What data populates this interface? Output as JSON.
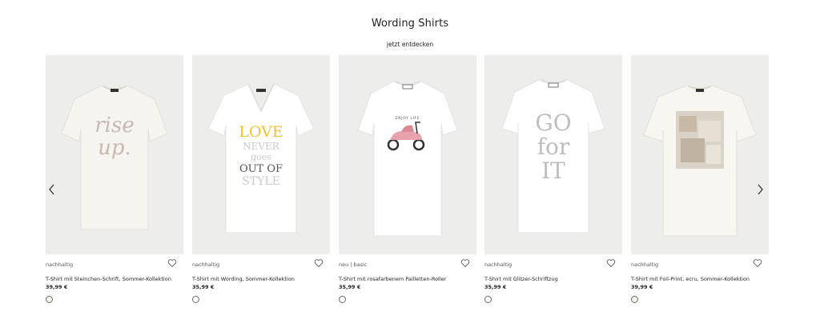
{
  "header": {
    "title": "Wording Shirts",
    "link": "jetzt entdecken"
  },
  "carousel": {
    "prev_icon": "chevron-left-icon",
    "next_icon": "chevron-right-icon",
    "products": [
      {
        "tag": "nachhaltig",
        "name": "T-Shirt mit Steinchen-Schrift, Sommer-Kollektion",
        "price": "39,99 €",
        "swatch": "#f5f3ea",
        "print": [
          "rise",
          "up."
        ],
        "shirt_color": "#f6f4ee"
      },
      {
        "tag": "nachhaltig",
        "name": "T-Shirt mit Wording, Sommer-Kollektion",
        "price": "35,99 €",
        "swatch": "#ffffff",
        "print": [
          "LOVE",
          "NEVER",
          "goes",
          "OUT OF",
          "STYLE"
        ],
        "shirt_color": "#ffffff"
      },
      {
        "tag": "neu   | basic",
        "name": "T-Shirt mit rosafarbenem Pailletten-Roller",
        "price": "35,99 €",
        "swatch": "#ffffff",
        "print": [
          "ENJOY LIFE"
        ],
        "shirt_color": "#ffffff"
      },
      {
        "tag": "nachhaltig",
        "name": "T-Shirt mit Glitzer-Schriftzug",
        "price": "35,99 €",
        "swatch": "#ffffff",
        "print": [
          "GO",
          "for",
          "IT"
        ],
        "shirt_color": "#ffffff"
      },
      {
        "tag": "nachhaltig",
        "name": "T-Shirt mit Foil-Print, ecru, Sommer-Kollektion",
        "price": "39,99 €",
        "swatch": "#f5f3ea",
        "print": [],
        "shirt_color": "#f7f6f1"
      }
    ]
  }
}
